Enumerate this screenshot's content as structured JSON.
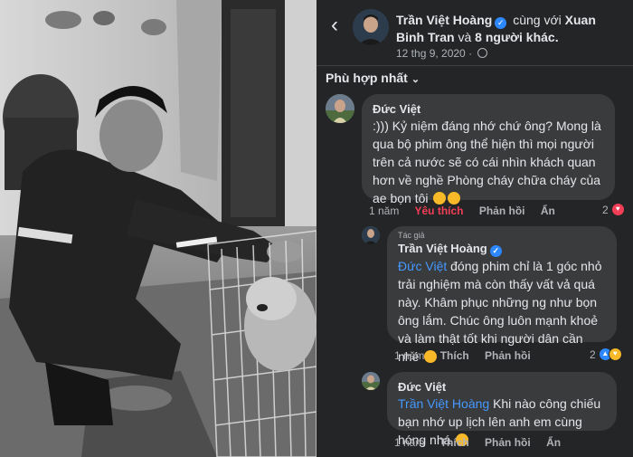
{
  "post": {
    "author": "Trần Việt Hoàng",
    "with_text": "cùng với",
    "tagged": "Xuan Binh Tran",
    "and_text": "và",
    "others": "8 người khác.",
    "date": "12 thg 9, 2020",
    "privacy_icon": "globe-icon"
  },
  "sort_label": "Phù hợp nhất",
  "comments": [
    {
      "name": "Đức Việt",
      "text": ":))) Kỷ niệm đáng nhớ chứ ông? Mong là qua bộ phim ông thể hiện thì mọi người trên cả nước sẽ có cái nhìn khách quan hơn về nghề Phòng cháy chữa cháy của ae bọn tôi",
      "emoji": "ok-hand-emoji",
      "time": "1 năm",
      "like_label": "Yêu thích",
      "reply_label": "Phản hồi",
      "hide_label": "Ẩn",
      "reaction_count": "2"
    },
    {
      "author_tag": "Tác giả",
      "name": "Trần Việt Hoàng",
      "mention": "Đức Việt",
      "text": "đóng phim chỉ là 1 góc nhỏ trải nghiệm mà còn thấy vất vả quá này. Khâm phục những ng như bọn ông lắm. Chúc ông luôn mạnh khoẻ và làm thật tốt khi người dân cần nhé",
      "emoji": "smile-emoji",
      "time": "1 năm",
      "like_label": "Thích",
      "reply_label": "Phản hồi",
      "reaction_count": "2"
    },
    {
      "name": "Đức Việt",
      "mention": "Trần Việt Hoàng",
      "text": "Khi nào công chiếu bạn nhớ up lịch lên anh em cùng hóng nhá",
      "emoji": "ok-hand-emoji",
      "time": "1 năm",
      "like_label": "Thích",
      "reply_label": "Phản hồi",
      "hide_label": "Ẩn"
    }
  ],
  "colors": {
    "background": "#242526",
    "bubble": "#3a3b3c",
    "link": "#4599ff",
    "love": "#f33e58",
    "verified": "#2d88ff"
  }
}
